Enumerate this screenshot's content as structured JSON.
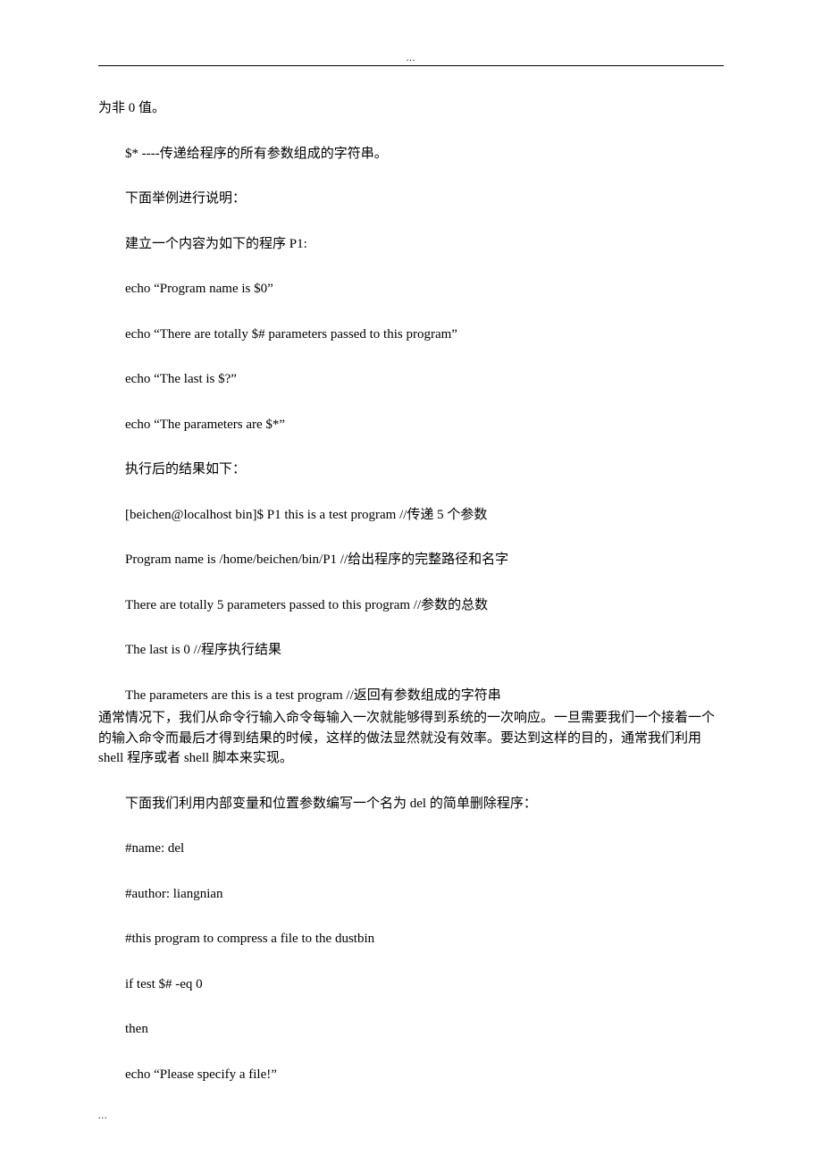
{
  "header": {
    "ellipsis": "..."
  },
  "lines": {
    "l0": "为非 0 值。",
    "l1": "$* ----传递给程序的所有参数组成的字符串。",
    "l2": "下面举例进行说明：",
    "l3": "建立一个内容为如下的程序 P1:",
    "l4": "echo “Program name is $0”",
    "l5": "echo “There are totally $# parameters passed to this program”",
    "l6": "echo “The last is $?”",
    "l7": "echo “The parameters are $*”",
    "l8": "执行后的结果如下：",
    "l9": "[beichen@localhost bin]$ P1 this is a test program //传递 5 个参数",
    "l10": "Program name is /home/beichen/bin/P1 //给出程序的完整路径和名字",
    "l11": "There are totally 5 parameters passed to this program //参数的总数",
    "l12": "The last is 0 //程序执行结果",
    "l13": "The parameters are this is a test program //返回有参数组成的字符串",
    "l14": "通常情况下，我们从命令行输入命令每输入一次就能够得到系统的一次响应。一旦需要我们一个接着一个的输入命令而最后才得到结果的时候，这样的做法显然就没有效率。要达到这样的目的，通常我们利用 shell 程序或者 shell 脚本来实现。",
    "l15": "下面我们利用内部变量和位置参数编写一个名为 del 的简单删除程序：",
    "l16": "#name: del",
    "l17": "#author: liangnian",
    "l18": "#this program to compress a file to the dustbin",
    "l19": "if test $# -eq 0",
    "l20": "then",
    "l21": "echo “Please specify a file!”"
  },
  "footer": {
    "ellipsis": "..."
  }
}
